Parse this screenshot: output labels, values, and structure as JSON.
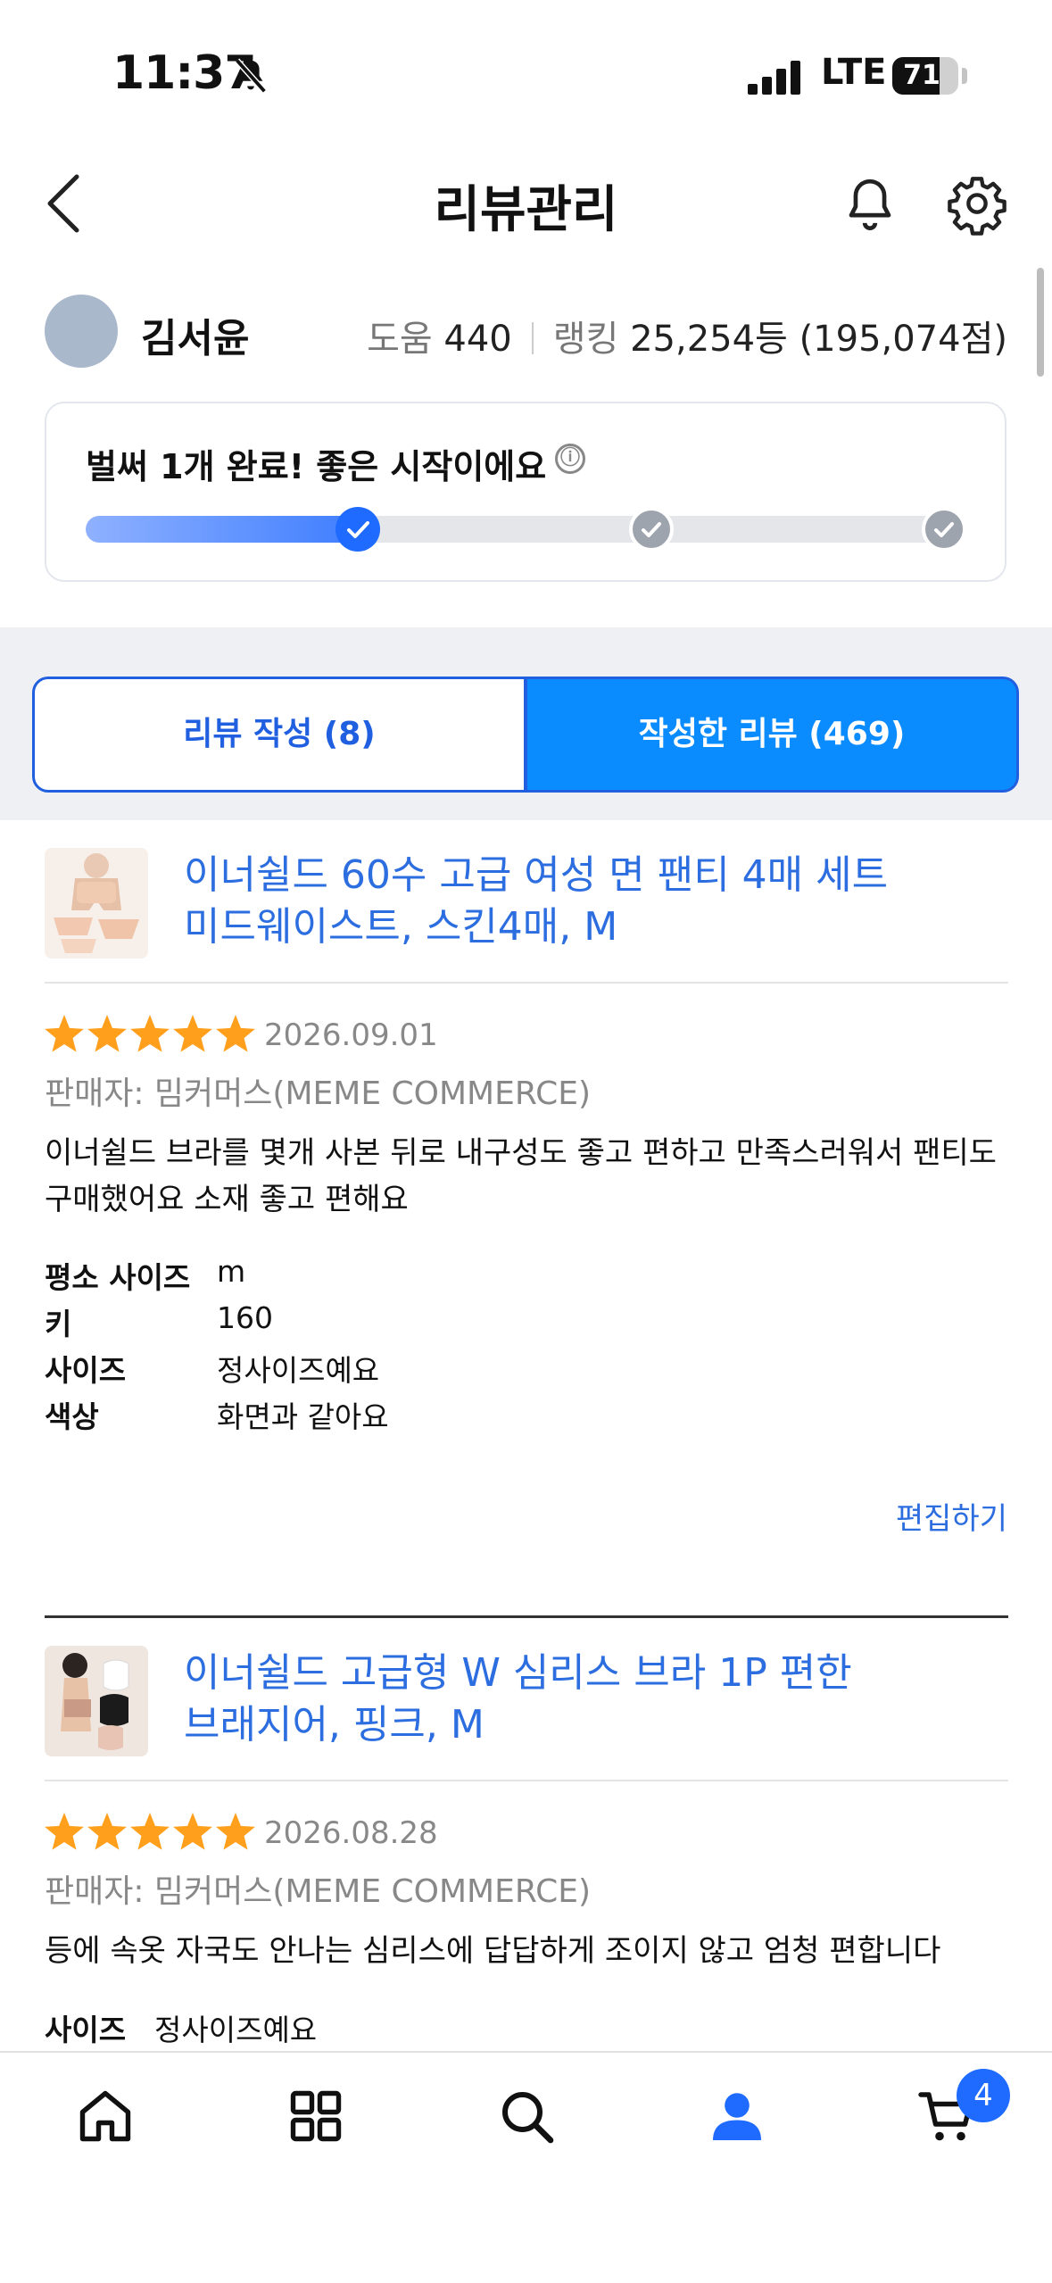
{
  "status_bar": {
    "time": "11:37",
    "network": "LTE",
    "battery": "71",
    "battery_level": 0.71
  },
  "header": {
    "title": "리뷰관리"
  },
  "profile": {
    "name": "김서윤",
    "help_label": "도움",
    "help_value": "440",
    "rank_label": "랭킹",
    "rank_value": "25,254등 (195,074점)"
  },
  "progress_card": {
    "title": "벌써 1개 완료! 좋은 시작이에요",
    "info_icon": "ⓘ",
    "progress": 0.33,
    "steps_completed": 1,
    "steps_total": 3
  },
  "tabs": [
    {
      "label": "리뷰 작성 (8)",
      "active": false
    },
    {
      "label": "작성한 리뷰 (469)",
      "active": true
    }
  ],
  "reviews": [
    {
      "product_line1": "이너쉴드 60수 고급 여성 면 팬티 4매 세트",
      "product_line2": "미드웨이스트, 스킨4매, M",
      "rating": 5,
      "date": "2026.09.01",
      "seller": "판매자: 밈커머스(MEME COMMERCE)",
      "body": "이너쉴드 브라를 몇개 사본 뒤로 내구성도 좋고 편하고 만족스러워서 팬티도 구매했어요 소재 좋고 편해요",
      "specs": [
        {
          "key": "평소 사이즈",
          "value": "m"
        },
        {
          "key": "키",
          "value": "160"
        },
        {
          "key": "사이즈",
          "value": "정사이즈예요"
        },
        {
          "key": "색상",
          "value": "화면과 같아요"
        }
      ],
      "edit_label": "편집하기"
    },
    {
      "product_line1": "이너쉴드 고급형 W 심리스 브라 1P 편한",
      "product_line2": "브래지어, 핑크, M",
      "rating": 5,
      "date": "2026.08.28",
      "seller": "판매자: 밈커머스(MEME COMMERCE)",
      "body": "등에 속옷 자국도 안나는 심리스에 답답하게 조이지 않고 엄청 편합니다",
      "specs": [
        {
          "key": "사이즈",
          "value": "정사이즈예요"
        }
      ]
    }
  ],
  "bottom_nav": {
    "items": [
      "home-icon",
      "category-icon",
      "search-icon",
      "my-page-icon",
      "cart-icon"
    ],
    "active": "my-page-icon",
    "cart_count": "4"
  },
  "colors": {
    "accent": "#0a8cff",
    "link": "#2c6de0",
    "star": "#ff9f1c",
    "active_nav": "#1f6bff"
  }
}
